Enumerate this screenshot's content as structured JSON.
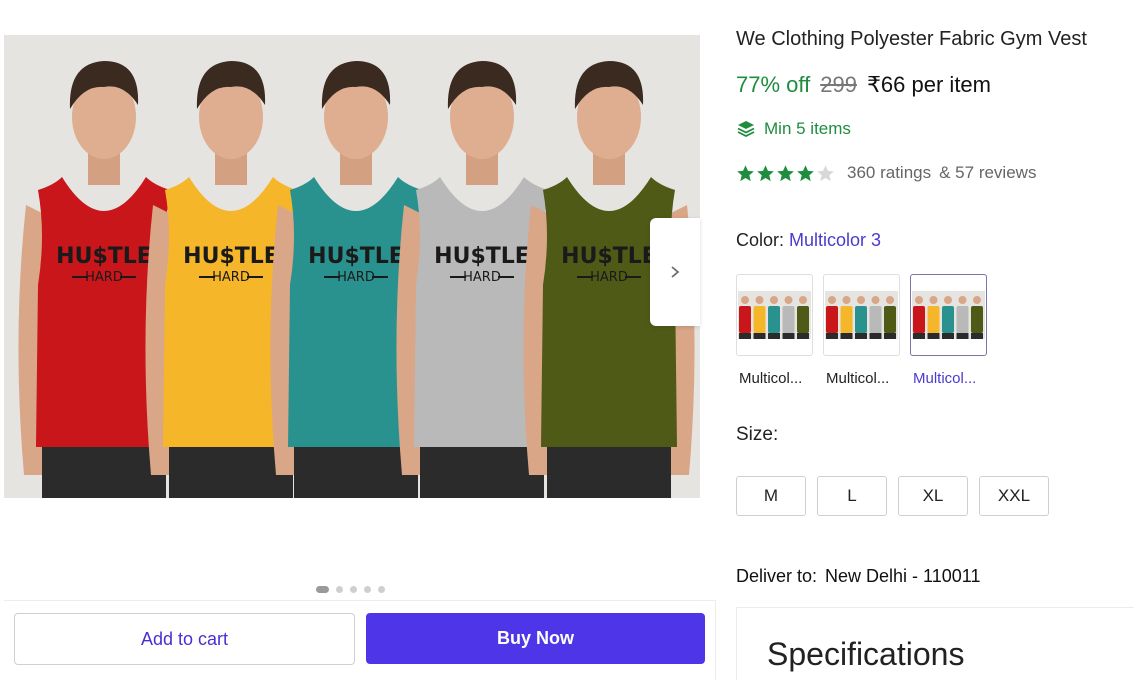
{
  "product": {
    "title": "We Clothing Polyester Fabric Gym Vest",
    "discount": "77% off",
    "mrp": "299",
    "price": "₹66 per item",
    "min_order": "Min 5 items",
    "rating_stars": 4,
    "ratings_text": "360 ratings",
    "reviews_text": "& 57 reviews"
  },
  "gallery": {
    "image_icon": "product-photo",
    "shirt_print_top": "HU$TLE",
    "shirt_print_bottom": "HARD",
    "shirt_colors": [
      "#c8161b",
      "#f5b62a",
      "#29928f",
      "#b9b9b9",
      "#4f5a16"
    ],
    "next_icon": "chevron-right-icon",
    "dots_count": 5,
    "active_dot": 0
  },
  "color": {
    "label": "Color:",
    "selected": "Multicolor 3",
    "options": [
      {
        "label": "Multicol...",
        "colors": [
          "#c8161b",
          "#f5b62a",
          "#29928f",
          "#b9b9b9",
          "#4f5a16"
        ]
      },
      {
        "label": "Multicol...",
        "colors": [
          "#c8161b",
          "#f5b62a",
          "#29928f",
          "#b9b9b9",
          "#4f5a16"
        ]
      },
      {
        "label": "Multicol...",
        "colors": [
          "#c8161b",
          "#f5b62a",
          "#29928f",
          "#b9b9b9",
          "#4f5a16"
        ]
      }
    ],
    "selected_index": 2
  },
  "size": {
    "label": "Size:",
    "options": [
      "M",
      "L",
      "XL",
      "XXL"
    ]
  },
  "delivery": {
    "label": "Deliver to:",
    "location": "New Delhi - 110011"
  },
  "specifications": {
    "title": "Specifications"
  },
  "actions": {
    "add_to_cart": "Add to cart",
    "buy_now": "Buy Now"
  },
  "theme": {
    "accent": "#4e35e8",
    "discount_green": "#1e8e3e",
    "star_green": "#1e8e3e"
  }
}
